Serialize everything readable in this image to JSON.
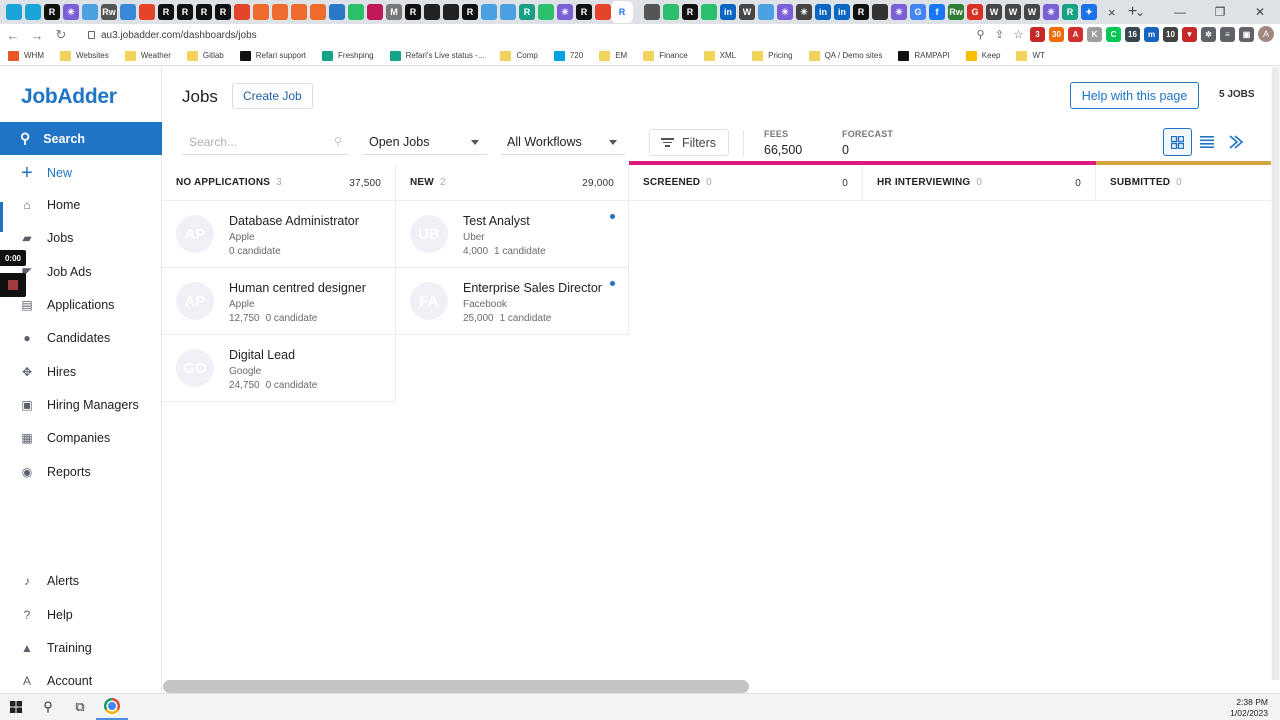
{
  "browser": {
    "url": "au3.jobadder.com/dashboards/jobs",
    "tab_favicons": [
      {
        "name": "teal",
        "color": "#1aa3d6",
        "glyph": ""
      },
      {
        "name": "teal",
        "color": "#1aa3d6",
        "glyph": ""
      },
      {
        "name": "r",
        "color": "#111111",
        "glyph": "R"
      },
      {
        "name": "asterisk",
        "color": "#7b5fd6",
        "glyph": "✳"
      },
      {
        "name": "blue",
        "color": "#4aa0e0",
        "glyph": ""
      },
      {
        "name": "rw",
        "color": "#555555",
        "glyph": "Rw"
      },
      {
        "name": "blue",
        "color": "#3a88d8",
        "glyph": ""
      },
      {
        "name": "gitlab",
        "color": "#e24329",
        "glyph": ""
      },
      {
        "name": "r",
        "color": "#111111",
        "glyph": "R"
      },
      {
        "name": "r",
        "color": "#111111",
        "glyph": "R"
      },
      {
        "name": "r",
        "color": "#111111",
        "glyph": "R"
      },
      {
        "name": "r",
        "color": "#111111",
        "glyph": "R"
      },
      {
        "name": "gitlab",
        "color": "#e24329",
        "glyph": ""
      },
      {
        "name": "orange",
        "color": "#ee6a2e",
        "glyph": ""
      },
      {
        "name": "orange",
        "color": "#ee6a2e",
        "glyph": ""
      },
      {
        "name": "orange",
        "color": "#ee6a2e",
        "glyph": ""
      },
      {
        "name": "orange",
        "color": "#ee6a2e",
        "glyph": ""
      },
      {
        "name": "drop",
        "color": "#2a79c8",
        "glyph": ""
      },
      {
        "name": "green",
        "color": "#2cbf6b",
        "glyph": ""
      },
      {
        "name": "mail",
        "color": "#c2185b",
        "glyph": ""
      },
      {
        "name": "md",
        "color": "#777777",
        "glyph": "M"
      },
      {
        "name": "r",
        "color": "#111111",
        "glyph": "R"
      },
      {
        "name": "dark",
        "color": "#222222",
        "glyph": ""
      },
      {
        "name": "dark",
        "color": "#222222",
        "glyph": ""
      },
      {
        "name": "r",
        "color": "#111111",
        "glyph": "R"
      },
      {
        "name": "blue",
        "color": "#4aa0e0",
        "glyph": ""
      },
      {
        "name": "blue",
        "color": "#4aa0e0",
        "glyph": ""
      },
      {
        "name": "r",
        "color": "#16a085",
        "glyph": "R"
      },
      {
        "name": "green",
        "color": "#2cbf6b",
        "glyph": ""
      },
      {
        "name": "asterisk",
        "color": "#7b5fd6",
        "glyph": "✳"
      },
      {
        "name": "r",
        "color": "#111111",
        "glyph": "R"
      },
      {
        "name": "gitlab",
        "color": "#e24329",
        "glyph": ""
      },
      {
        "name": "r-active",
        "color": "#16a085",
        "glyph": "R"
      },
      {
        "name": "gap",
        "color": "transparent",
        "glyph": ""
      },
      {
        "name": "gpt",
        "color": "#555555",
        "glyph": ""
      },
      {
        "name": "green",
        "color": "#2cbf6b",
        "glyph": ""
      },
      {
        "name": "r",
        "color": "#111111",
        "glyph": "R"
      },
      {
        "name": "green",
        "color": "#2cbf6b",
        "glyph": ""
      },
      {
        "name": "linkedin",
        "color": "#0a66c2",
        "glyph": "in"
      },
      {
        "name": "wp",
        "color": "#464646",
        "glyph": "W"
      },
      {
        "name": "blue",
        "color": "#4aa0e0",
        "glyph": ""
      },
      {
        "name": "asterisk",
        "color": "#7b5fd6",
        "glyph": "✳"
      },
      {
        "name": "asterisk",
        "color": "#444444",
        "glyph": "✳"
      },
      {
        "name": "linkedin",
        "color": "#0a66c2",
        "glyph": "in"
      },
      {
        "name": "linkedin",
        "color": "#0a66c2",
        "glyph": "in"
      },
      {
        "name": "r",
        "color": "#111111",
        "glyph": "R"
      },
      {
        "name": "dark",
        "color": "#333333",
        "glyph": ""
      },
      {
        "name": "asterisk",
        "color": "#7b5fd6",
        "glyph": "✳"
      },
      {
        "name": "google",
        "color": "#4285f4",
        "glyph": "G"
      },
      {
        "name": "facebook",
        "color": "#1877f2",
        "glyph": "f"
      },
      {
        "name": "rw",
        "color": "#2e7d32",
        "glyph": "Rw"
      },
      {
        "name": "g-red",
        "color": "#d93025",
        "glyph": "G"
      },
      {
        "name": "wp",
        "color": "#464646",
        "glyph": "W"
      },
      {
        "name": "wp",
        "color": "#464646",
        "glyph": "W"
      },
      {
        "name": "wp",
        "color": "#464646",
        "glyph": "W"
      },
      {
        "name": "asterisk",
        "color": "#7b5fd6",
        "glyph": "✳"
      },
      {
        "name": "r",
        "color": "#16a085",
        "glyph": "R"
      },
      {
        "name": "sparkle",
        "color": "#1a73e8",
        "glyph": "✦"
      }
    ],
    "window_controls": {
      "close_tab": "×",
      "new_tab": "+",
      "chevron": "⌄",
      "minimize": "—",
      "restore": "❐",
      "close": "✕"
    },
    "extensions": [
      {
        "name": "ext-red",
        "color": "#c62828",
        "glyph": "3"
      },
      {
        "name": "ext-orange",
        "color": "#ef6c00",
        "glyph": "30"
      },
      {
        "name": "ext-pdf",
        "color": "#d32f2f",
        "glyph": "A"
      },
      {
        "name": "ext-grey",
        "color": "#9e9e9e",
        "glyph": "K"
      },
      {
        "name": "ext-green",
        "color": "#00c853",
        "glyph": "C"
      },
      {
        "name": "ext-dark",
        "color": "#37474f",
        "glyph": "16"
      },
      {
        "name": "ext-blue",
        "color": "#1565c0",
        "glyph": "m"
      },
      {
        "name": "ext-dark2",
        "color": "#424242",
        "glyph": "10"
      },
      {
        "name": "ext-shield",
        "color": "#c62828",
        "glyph": "▼"
      },
      {
        "name": "ext-puzzle",
        "color": "#5f6368",
        "glyph": "✲"
      },
      {
        "name": "ext-list",
        "color": "#5f6368",
        "glyph": "≡"
      },
      {
        "name": "ext-sidebar",
        "color": "#5f6368",
        "glyph": "▣"
      }
    ],
    "profile_initial": "A",
    "bookmarks": [
      {
        "label": "WHM",
        "color": "#e8562a"
      },
      {
        "label": "Websites",
        "color": "#f2d35b"
      },
      {
        "label": "Weather",
        "color": "#f2d35b"
      },
      {
        "label": "Gitlab",
        "color": "#f2d35b"
      },
      {
        "label": "Refari support",
        "color": "#111111"
      },
      {
        "label": "Freshping",
        "color": "#17a589"
      },
      {
        "label": "Refari's Live status -...",
        "color": "#17a589"
      },
      {
        "label": "Comp",
        "color": "#f2d35b"
      },
      {
        "label": "720",
        "color": "#00a1e0"
      },
      {
        "label": "EM",
        "color": "#f2d35b"
      },
      {
        "label": "Finance",
        "color": "#f2d35b"
      },
      {
        "label": "XML",
        "color": "#f2d35b"
      },
      {
        "label": "Pricing",
        "color": "#f2d35b"
      },
      {
        "label": "QA / Demo sites",
        "color": "#f2d35b"
      },
      {
        "label": "RAMPAPI",
        "color": "#111111"
      },
      {
        "label": "Keep",
        "color": "#fbbc04"
      },
      {
        "label": "WT",
        "color": "#f2d35b"
      }
    ]
  },
  "sidebar": {
    "logo": "JobAdder",
    "search_label": "Search",
    "new_label": "New",
    "items": [
      {
        "label": "Home",
        "icon": "home-icon",
        "glyph": "⌂"
      },
      {
        "label": "Jobs",
        "icon": "briefcase-icon",
        "glyph": "▰"
      },
      {
        "label": "Job Ads",
        "icon": "megaphone-icon",
        "glyph": "◤"
      },
      {
        "label": "Applications",
        "icon": "document-icon",
        "glyph": "▤"
      },
      {
        "label": "Candidates",
        "icon": "person-icon",
        "glyph": "●"
      },
      {
        "label": "Hires",
        "icon": "handshake-icon",
        "glyph": "✥"
      },
      {
        "label": "Hiring Managers",
        "icon": "badge-icon",
        "glyph": "▣"
      },
      {
        "label": "Companies",
        "icon": "building-icon",
        "glyph": "▦"
      },
      {
        "label": "Reports",
        "icon": "report-icon",
        "glyph": "◉"
      }
    ],
    "bottom_items": [
      {
        "label": "Alerts",
        "icon": "bell-icon",
        "glyph": "♪"
      },
      {
        "label": "Help",
        "icon": "help-icon",
        "glyph": "?"
      },
      {
        "label": "Training",
        "icon": "graduation-icon",
        "glyph": "▲"
      },
      {
        "label": "Account",
        "icon": "account-icon",
        "glyph": "A"
      }
    ]
  },
  "recorder": {
    "timer": "0:00"
  },
  "header": {
    "title": "Jobs",
    "create_job": "Create Job",
    "help": "Help with this page",
    "count": "5 JOBS"
  },
  "filters": {
    "search_placeholder": "Search...",
    "status": "Open Jobs",
    "workflow": "All Workflows",
    "filters_label": "Filters",
    "fees_label": "FEES",
    "fees_value": "66,500",
    "forecast_label": "FORECAST",
    "forecast_value": "0"
  },
  "colors": {
    "brand": "#1f74c6",
    "stage_screened": "#d81b7c",
    "stage_submitted": "#d4a53c"
  },
  "columns": [
    {
      "name": "NO APPLICATIONS",
      "count": "3",
      "sum": "37,500"
    },
    {
      "name": "NEW",
      "count": "2",
      "sum": "29,000"
    },
    {
      "name": "SCREENED",
      "count": "0",
      "sum": "0"
    },
    {
      "name": "HR INTERVIEWING",
      "count": "0",
      "sum": "0"
    },
    {
      "name": "SUBMITTED",
      "count": "0",
      "sum": ""
    }
  ],
  "cards": {
    "no_applications": [
      {
        "initials": "AP",
        "title": "Database Administrator",
        "company": "Apple",
        "fee": "",
        "candidates": "0 candidate"
      },
      {
        "initials": "AP",
        "title": "Human centred designer",
        "company": "Apple",
        "fee": "12,750",
        "candidates": "0 candidate"
      },
      {
        "initials": "GO",
        "title": "Digital Lead",
        "company": "Google",
        "fee": "24,750",
        "candidates": "0 candidate"
      }
    ],
    "new": [
      {
        "initials": "UB",
        "title": "Test Analyst",
        "company": "Uber",
        "fee": "4,000",
        "candidates": "1 candidate"
      },
      {
        "initials": "FA",
        "title": "Enterprise Sales Director",
        "company": "Facebook",
        "fee": "25,000",
        "candidates": "1 candidate"
      }
    ]
  },
  "taskbar": {
    "time": "2:38 PM",
    "date": "1/02/2023"
  }
}
